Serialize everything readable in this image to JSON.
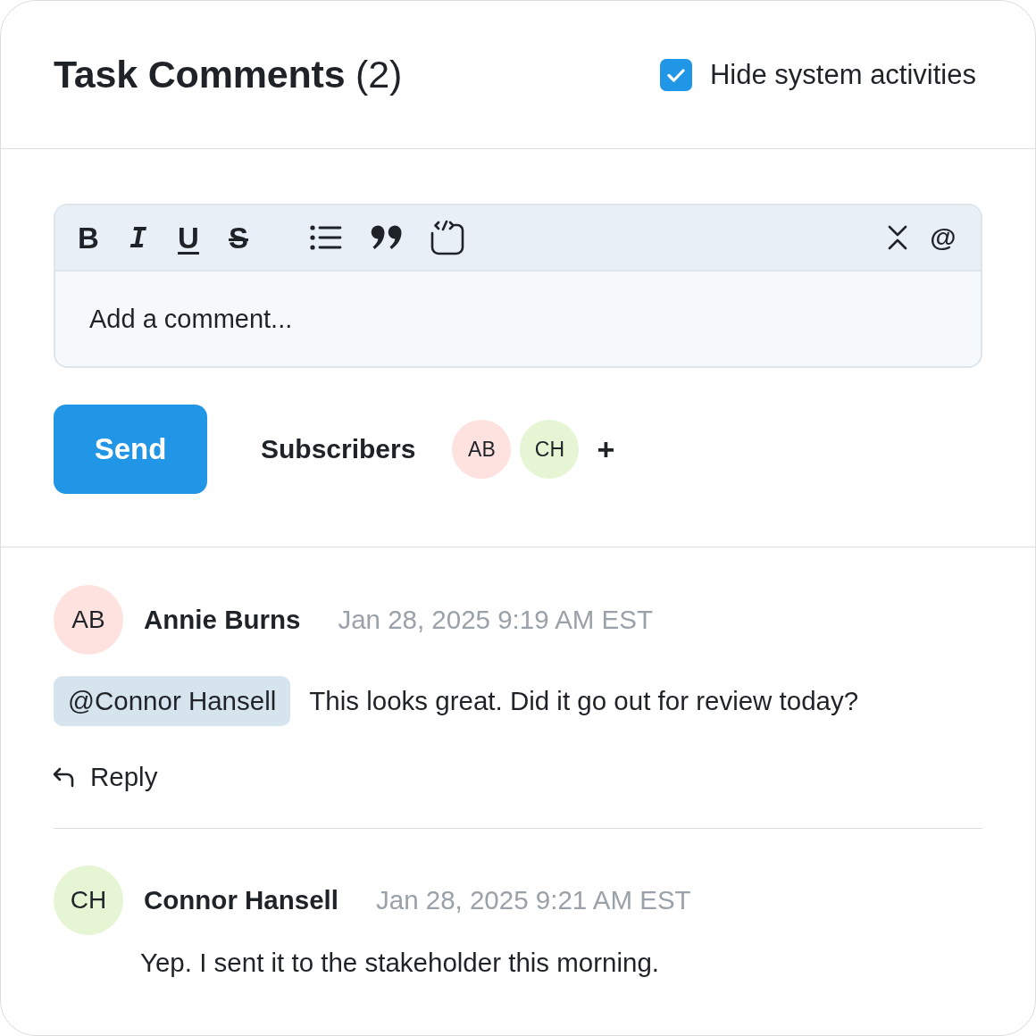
{
  "header": {
    "title": "**Task Comments** (2)",
    "hide_system": {
      "label": "Hide system activities",
      "checked": true
    }
  },
  "editor": {
    "format_tools": [
      {
        "kind": "bold",
        "label": "B"
      },
      {
        "kind": "italic",
        "label": "I"
      },
      {
        "kind": "underline",
        "label": "U"
      },
      {
        "kind": "strike",
        "label": "S"
      }
    ],
    "insert_tools": [
      {
        "kind": "list"
      },
      {
        "kind": "quote"
      },
      {
        "kind": "code"
      }
    ],
    "side_tools": [
      {
        "kind": "collapse"
      },
      {
        "kind": "mention",
        "label": "@"
      }
    ],
    "placeholder": "Add a comment..."
  },
  "actions": {
    "send": "Send",
    "subscribers_label": "Subscribers",
    "subscribers": [
      {
        "initials": "AB",
        "color": "#fde2df"
      },
      {
        "initials": "CH",
        "color": "#e6f6d4"
      }
    ],
    "add": "+"
  },
  "comments": [
    {
      "initials": "AB",
      "color": "#fde2df",
      "author": "Annie Burns",
      "time": "Jan 28, 2025 9:19 AM EST",
      "mention": "@Connor Hansell",
      "text": "This looks great. Did it go out for review today?",
      "reply": "Reply"
    },
    {
      "initials": "CH",
      "color": "#e6f6d4",
      "author": "Connor Hansell",
      "time": "Jan 28, 2025 9:21 AM EST",
      "text": "Yep. I sent it to the stakeholder this morning."
    }
  ]
}
